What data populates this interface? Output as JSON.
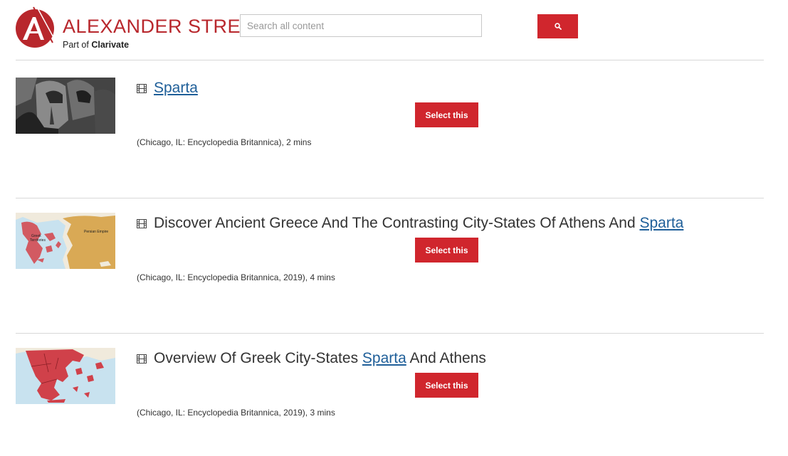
{
  "header": {
    "brand_name": "ALEXANDER STREET",
    "brand_part_prefix": "Part of",
    "brand_part_company": "Clarivate",
    "search_placeholder": "Search all content",
    "search_value": "",
    "search_button_icon": "search-icon",
    "brand_color": "#b8272c"
  },
  "results": [
    {
      "type_icon": "film-icon",
      "title_before": "",
      "title_link": "Sparta",
      "title_after": "",
      "select_label": "Select this",
      "meta": "(Chicago, IL: Encyclopedia Britannica), 2 mins",
      "thumbnail": "spartan-helmet-image"
    },
    {
      "type_icon": "film-icon",
      "title_before": "Discover Ancient Greece And The Contrasting City-States Of Athens And ",
      "title_link": "Sparta",
      "title_after": "",
      "select_label": "Select this",
      "meta": "(Chicago, IL: Encyclopedia Britannica, 2019), 4 mins",
      "thumbnail": "greece-persia-map-image",
      "thumb_labels": [
        "Greek",
        "Territories",
        "Persian Empire"
      ]
    },
    {
      "type_icon": "film-icon",
      "title_before": "Overview Of Greek City-States ",
      "title_link": "Sparta",
      "title_after": " And Athens",
      "select_label": "Select this",
      "meta": "(Chicago, IL: Encyclopedia Britannica, 2019), 3 mins",
      "thumbnail": "greek-city-states-map-image"
    }
  ],
  "colors": {
    "accent_red": "#d0262d",
    "link_blue": "#1f5f99"
  }
}
